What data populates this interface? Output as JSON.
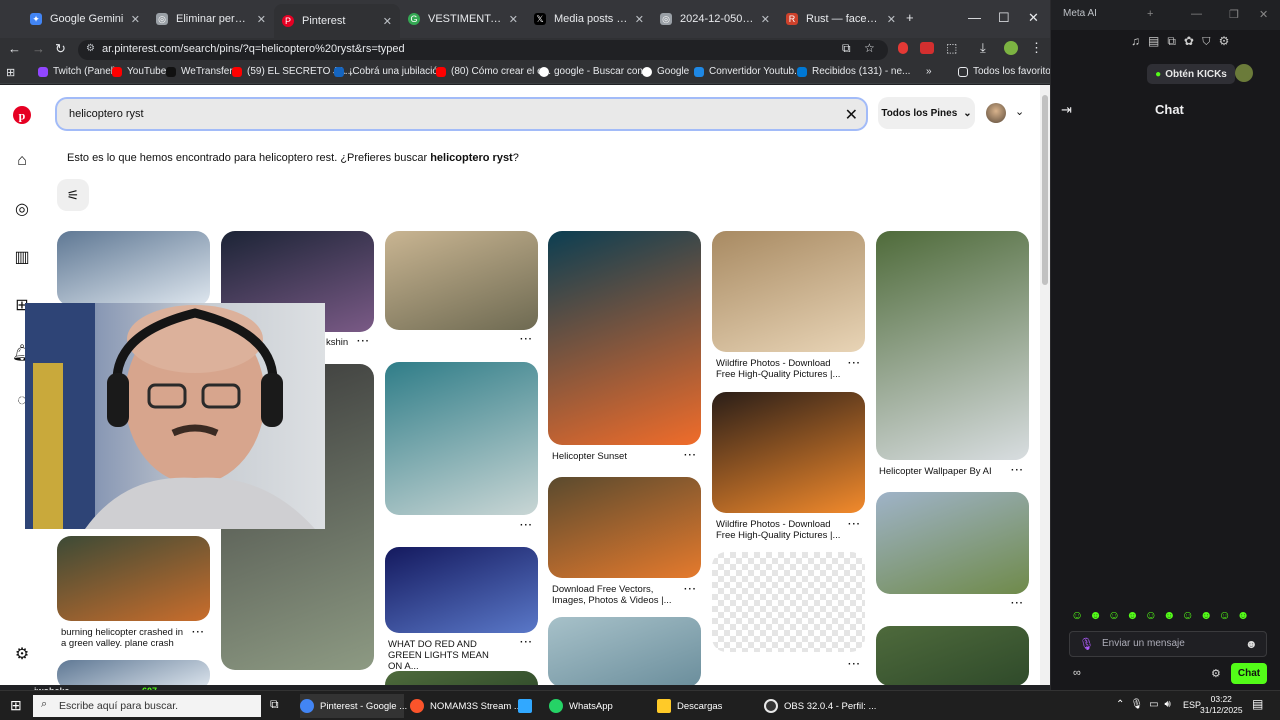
{
  "browser": {
    "tabs": [
      {
        "title": "Google Gemini",
        "color": "#4285f4"
      },
      {
        "title": "Eliminar personaje y",
        "color": "#9aa0a6"
      },
      {
        "title": "Pinterest",
        "color": "#e60023"
      },
      {
        "title": "VESTIMENTA rust - B",
        "color": "#34a853"
      },
      {
        "title": "Media posts by Rust",
        "color": "#000000"
      },
      {
        "title": "2024-12-0508-52-40.",
        "color": "#9aa0a6"
      },
      {
        "title": "Rust — facepunch",
        "color": "#cd412b"
      }
    ],
    "url": "ar.pinterest.com/search/pins/?q=helicoptero%20ryst&rs=typed",
    "bookmarks": [
      "Twitch (Panel)",
      "YouTube",
      "WeTransfer",
      "(59) EL SECRETO JA...",
      "¡Cobrá una jubilació...",
      "(80) Cómo crear el e...",
      "google - Buscar con...",
      "Google",
      "Convertidor Youtub...",
      "Recibidos (131) - ne..."
    ],
    "bookmarks_all": "Todos los favoritos"
  },
  "pinterest": {
    "search_value": "helicoptero ryst",
    "filter_label": "Todos los Pines",
    "suggest_prefix": "Esto es lo que hemos encontrado para helicoptero rest. ¿Prefieres buscar ",
    "suggest_term": "helicoptero ryst",
    "suggest_suffix": "?",
    "pins": [
      {
        "caption": "",
        "colors": [
          "#5f7894",
          "#dfe7ef"
        ]
      },
      {
        "caption": "kshin",
        "colors": [
          "#1c2436",
          "#7a5a86"
        ]
      },
      {
        "caption": "",
        "colors": [
          "#c9b592",
          "#6e6a52"
        ]
      },
      {
        "caption": "",
        "colors": [
          "#3b3b3b",
          "#8d9a83"
        ]
      },
      {
        "caption": "",
        "colors": [
          "#2f7d88",
          "#c9d6d5"
        ]
      },
      {
        "caption": "",
        "colors": [
          "#0b3e52",
          "#f06c2a"
        ]
      },
      {
        "caption": "Helicopter Sunset",
        "colors": [
          "#0d1a1a",
          "#e55b22"
        ]
      },
      {
        "caption": "",
        "colors": [
          "#a88a62",
          "#e8d4b6"
        ]
      },
      {
        "caption": "Wildfire Photos - Download Free High-Quality Pictures |...",
        "colors": [
          "#3b3024",
          "#d88a44"
        ]
      },
      {
        "caption": "Wildfire Photos - Download Free High-Quality Pictures |...",
        "colors": [
          "#2a1e18",
          "#f28a2c"
        ]
      },
      {
        "caption": "Helicopter Wallpaper By AI",
        "colors": [
          "#4f6b3a",
          "#d8dde0"
        ]
      },
      {
        "caption": "",
        "colors": [
          "#9fb3c8",
          "#6f8a4a"
        ]
      },
      {
        "caption": "burning helicopter crashed in a green valley. plane crash",
        "colors": [
          "#3c4a36",
          "#c96d2c"
        ]
      },
      {
        "caption": "WHAT DO RED AND GREEN LIGHTS MEAN ON A...",
        "colors": [
          "#14195e",
          "#5a78c8"
        ]
      },
      {
        "caption": "Download Free Vectors, Images, Photos & Videos |...",
        "colors": [
          "#5a4a2e",
          "#e57a2d"
        ]
      },
      {
        "caption": "",
        "colors": [
          "#e0e0e0",
          "#ffffff"
        ]
      },
      {
        "caption": "",
        "colors": [
          "#a7c1c9",
          "#6b8e9c"
        ]
      },
      {
        "caption": "",
        "colors": [
          "#4e6a3c",
          "#2f4a2a"
        ]
      }
    ]
  },
  "webcam_overlay": {
    "username": "iwobeka",
    "viewers": "607"
  },
  "sidepanel": {
    "window_title": "Meta AI",
    "kicks_label": "Obtén KICKs",
    "chat_title": "Chat",
    "input_placeholder": "Enviar un mensaje",
    "send_label": "Chat",
    "accent": "#53fc18"
  },
  "taskbar": {
    "search_placeholder": "Escribe aquí para buscar.",
    "items": [
      {
        "label": "Pinterest - Google ...",
        "color": "#4285f4"
      },
      {
        "label": "NOMAM3S Stream ...",
        "color": "#fb542b"
      },
      {
        "label": "",
        "color": "#31a8ff"
      },
      {
        "label": "WhatsApp",
        "color": "#25d366"
      },
      {
        "label": "Descargas",
        "color": "#ffca28"
      },
      {
        "label": "OBS 32.0.4 - Perfil: ...",
        "color": "#e8e8e8"
      }
    ],
    "language": "ESP",
    "time": "03:22",
    "date": "31/12/2025"
  }
}
